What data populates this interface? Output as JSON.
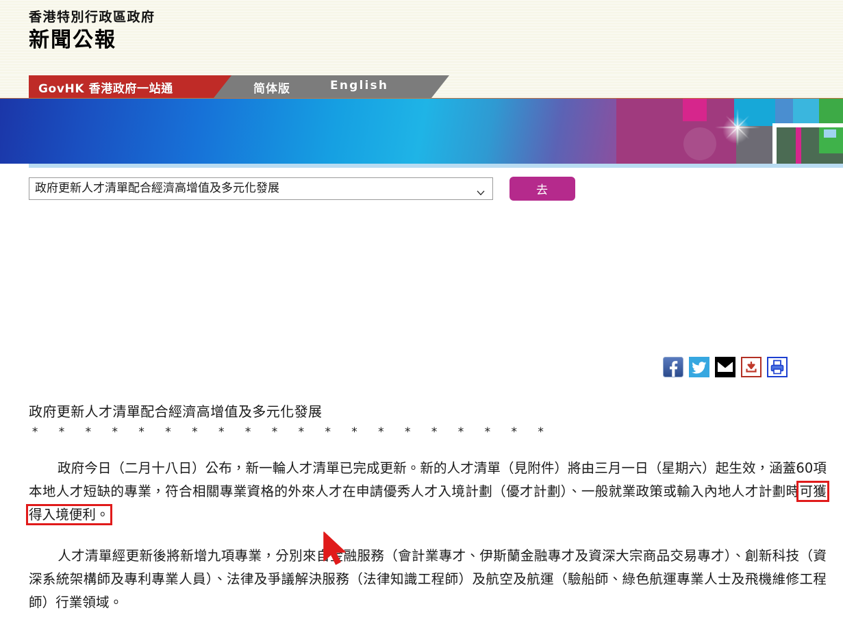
{
  "masthead": {
    "gov_line": "香港特別行政區政府",
    "bulletin_line": "新聞公報"
  },
  "tabs": {
    "govhk": "GovHK 香港政府一站通",
    "simplified": "简体版",
    "english": "English"
  },
  "toolbar": {
    "select_value": "政府更新人才清單配合經濟高增值及多元化發展",
    "go_label": "去",
    "caret_icon": "chevron-down-icon"
  },
  "social": {
    "items": [
      {
        "icon": "facebook-icon",
        "label": "Facebook",
        "color": "#3b5998"
      },
      {
        "icon": "twitter-icon",
        "label": "Twitter",
        "color": "#36a7e0"
      },
      {
        "icon": "email-icon",
        "label": "Email",
        "color": "#000000"
      },
      {
        "icon": "download-icon",
        "label": "Download",
        "color": "#c0392b"
      },
      {
        "icon": "print-icon",
        "label": "Print",
        "color": "#1c3fd0"
      }
    ]
  },
  "article": {
    "title": "政府更新人才清單配合經濟高增值及多元化發展",
    "stars": "*  *  *  *  *  *  *  *  *  *  *  *  *  *  *  *  *  *  *  *",
    "paragraph1_before": "政府今日（二月十八日）公布，新一輪人才清單已完成更新。新的人才清單（見附件）將由三月一日（星期六）起生效，涵蓋60項本地人才短缺的專業，符合相關專業資格的外來人才在申請優秀人才入境計劃（優才計劃）、一般就業政策或輸入內地人才計劃時",
    "paragraph1_highlight": "可獲得入境便利。",
    "paragraph2": "人才清單經更新後將新增九項專業，分別來自金融服務（會計業專才、伊斯蘭金融專才及資深大宗商品交易專才）、創新科技（資深系統架構師及專利專業人員）、法律及爭議解決服務（法律知識工程師）及航空及航運（驗船師、綠色航運專業人士及飛機維修工程師）行業領域。"
  },
  "colors": {
    "tab_red": "#bf2b27",
    "tab_gray": "#7c7c7c",
    "go_button": "#b52a8c",
    "highlight": "#e01b1b",
    "cursor": "#e01b1b",
    "masthead_bg": "#f7f6e9"
  },
  "cursor": {
    "icon": "mouse-pointer-icon"
  }
}
